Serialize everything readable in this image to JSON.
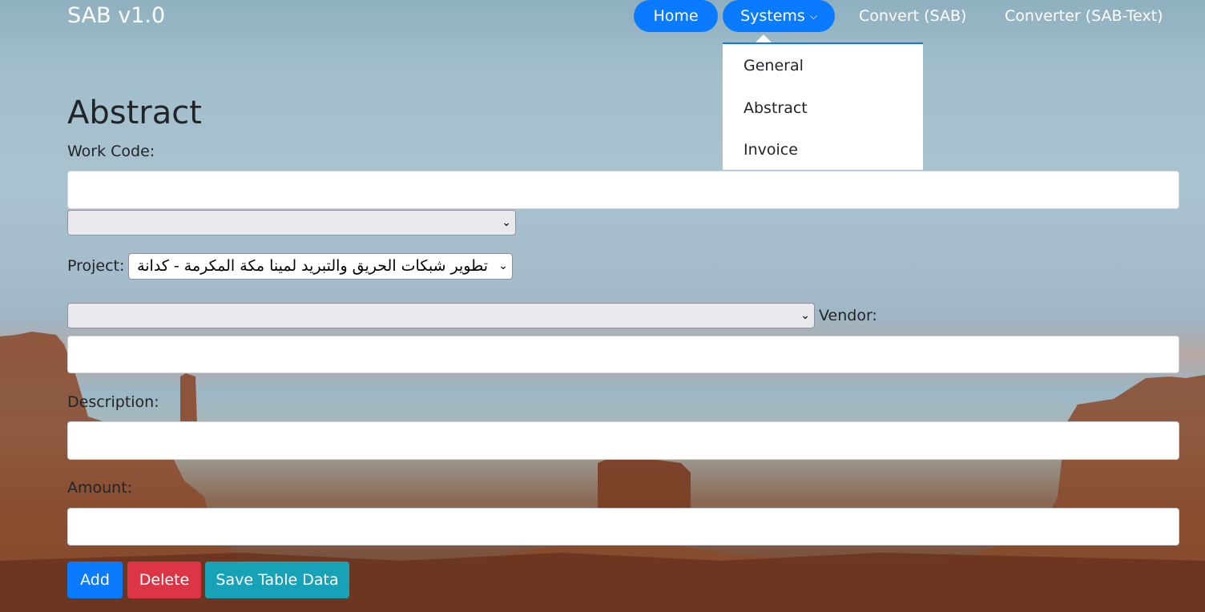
{
  "brand": "SAB v1.0",
  "nav": {
    "home": "Home",
    "systems": "Systems",
    "convert_sab": "Convert (SAB)",
    "converter_sab_text": "Converter (SAB-Text)"
  },
  "dropdown": {
    "items": [
      "General",
      "Abstract",
      "Invoice"
    ]
  },
  "page": {
    "title": "Abstract"
  },
  "form": {
    "work_code_label": "Work Code:",
    "work_code_value": "",
    "work_code_select_value": "",
    "project_label": "Project:",
    "project_select_value": "تطوير شبكات الحريق والتبريد لمينا مكة المكرمة - كدانة",
    "vendor_select_value": "",
    "vendor_label": "Vendor:",
    "vendor_value": "",
    "description_label": "Description:",
    "description_value": "",
    "amount_label": "Amount:",
    "amount_value": ""
  },
  "buttons": {
    "add": "Add",
    "delete": "Delete",
    "save": "Save Table Data"
  },
  "colors": {
    "primary": "#0a7bff",
    "danger": "#dc3545",
    "info": "#17a2b8"
  }
}
